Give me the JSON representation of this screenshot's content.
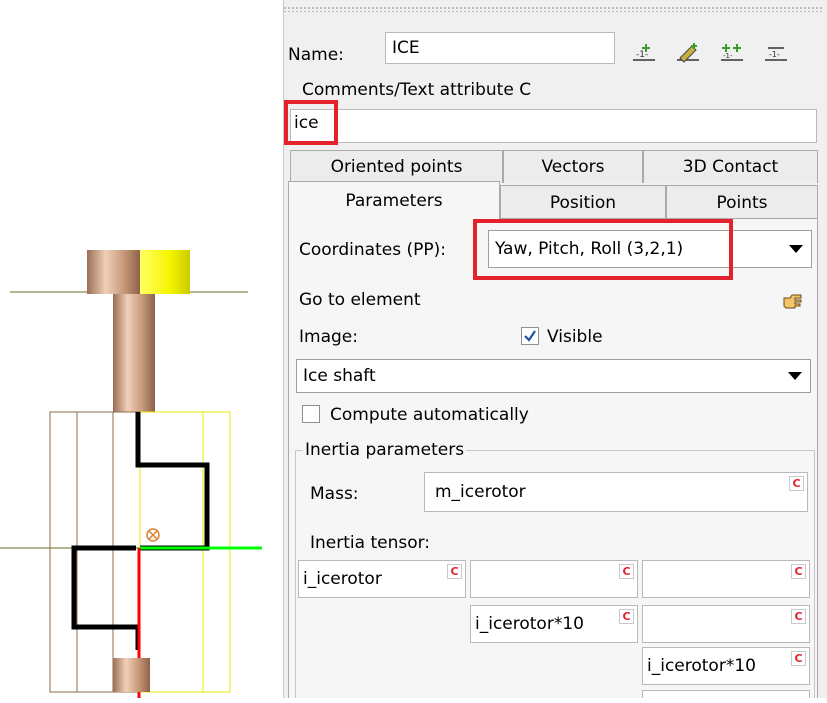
{
  "viewport": {
    "colors": {
      "shaft_gradient": "#b8876a",
      "highlight": "#ffff33",
      "axis_green": "#00ff00",
      "axis_red": "#ff0000",
      "outline_brown": "#8b6e4e",
      "outline_yellow": "#e8e800",
      "ref_line": "#6b6b2a"
    }
  },
  "name_label": "Name:",
  "name_value": "ICE",
  "toolbar_icons": [
    "add-point-icon",
    "edit-icon",
    "add-multiple-icon",
    "align-icon"
  ],
  "comments_label": "Comments/Text attribute C",
  "comments_value": "ice",
  "tabs_row1": [
    "Oriented points",
    "Vectors",
    "3D Contact"
  ],
  "tabs_row2": [
    "Parameters",
    "Position",
    "Points"
  ],
  "active_tab": "Parameters",
  "coordinates_label": "Coordinates (PP):",
  "coordinates_value": "Yaw, Pitch, Roll (3,2,1)",
  "goto_label": "Go to element",
  "goto_icon": "pointing-hand-icon",
  "image_label": "Image:",
  "visible_label": "Visible",
  "visible_checked": true,
  "image_value": "Ice shaft",
  "compute_label": "Compute automatically",
  "compute_checked": false,
  "inertia_group_label": "Inertia parameters",
  "mass_label": "Mass:",
  "mass_value": "m_icerotor",
  "tensor_label": "Inertia tensor:",
  "tensor": [
    [
      "i_icerotor",
      "",
      ""
    ],
    [
      "",
      "i_icerotor*10",
      ""
    ],
    [
      "",
      "",
      "i_icerotor*10"
    ]
  ],
  "c_button_label": "C",
  "highlight_color": "#e3232b"
}
